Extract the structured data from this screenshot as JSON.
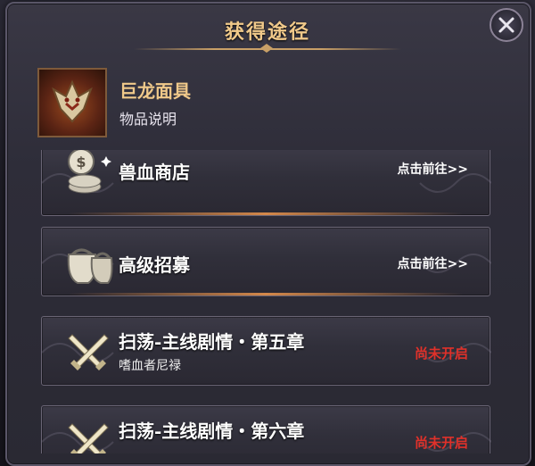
{
  "dialog": {
    "title": "获得途径"
  },
  "item": {
    "name": "巨龙面具",
    "description": "物品说明"
  },
  "sources": [
    {
      "icon": "coin-stack-icon",
      "title": "兽血商店",
      "subtitle": "",
      "action": "点击前往>>",
      "status": "available"
    },
    {
      "icon": "recruit-bag-icon",
      "title": "高级招募",
      "subtitle": "",
      "action": "点击前往>>",
      "status": "available"
    },
    {
      "icon": "crossed-swords-icon",
      "title": "扫荡-主线剧情・第五章",
      "subtitle": "嗜血者尼禄",
      "action": "尚未开启",
      "status": "locked"
    },
    {
      "icon": "crossed-swords-icon",
      "title": "扫荡-主线剧情・第六章",
      "subtitle": "",
      "action": "尚未开启",
      "status": "locked"
    }
  ],
  "colors": {
    "title": "#f0c98a",
    "locked_text": "#e0312a",
    "link_text": "#ffffff"
  }
}
